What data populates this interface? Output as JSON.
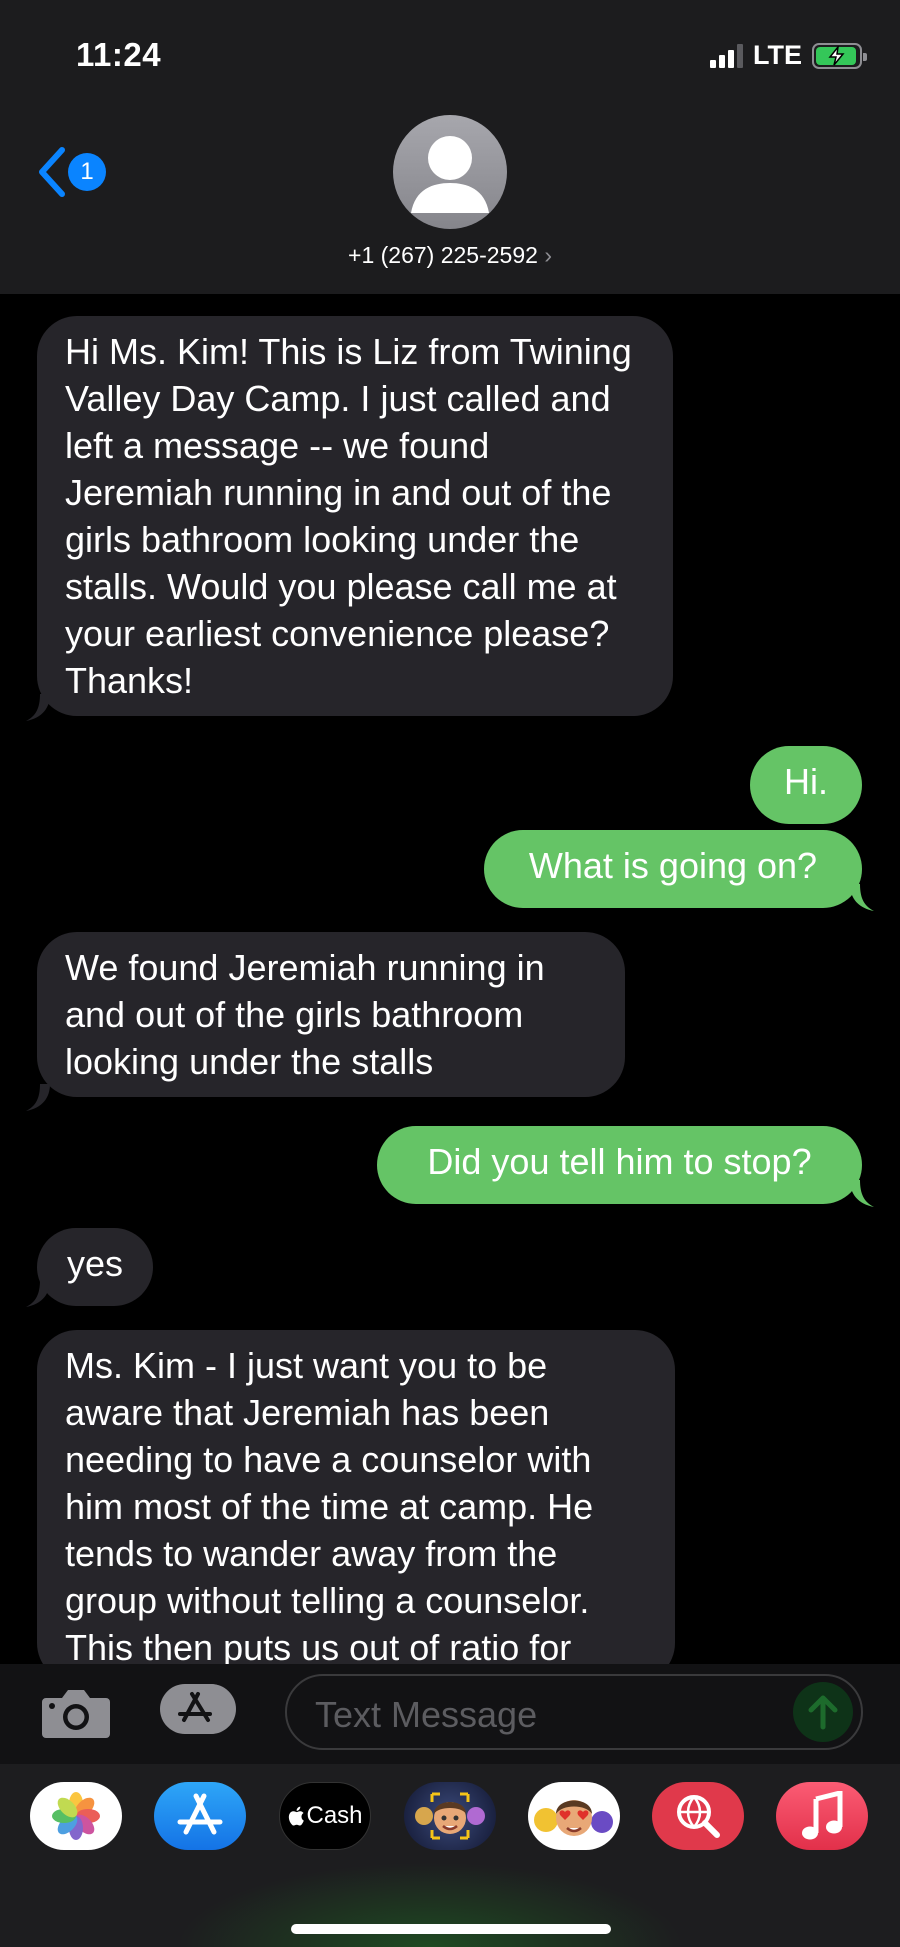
{
  "status_bar": {
    "time": "11:24",
    "network": "LTE"
  },
  "header": {
    "back_badge": "1",
    "contact_name": "+1 (267) 225-2592",
    "chevron": "›"
  },
  "messages": [
    {
      "dir": "in",
      "text": "Hi Ms. Kim! This is Liz from Twining Valley Day Camp. I just called and left a message -- we found Jeremiah running in and out of the girls bathroom looking under the stalls. Would you please call me at your earliest convenience please? Thanks!"
    },
    {
      "dir": "out",
      "text": "Hi."
    },
    {
      "dir": "out",
      "text": "What is going on?"
    },
    {
      "dir": "in",
      "text": "We found Jeremiah running in and out of the girls bathroom looking under the stalls"
    },
    {
      "dir": "out",
      "text": "Did you tell him to stop?"
    },
    {
      "dir": "in",
      "text": "yes"
    },
    {
      "dir": "in",
      "text": "Ms. Kim - I just want you to be aware that Jeremiah has been needing to have a counselor with him most of the time at camp. He tends to wander away from the group without telling a counselor. This then puts us out of ratio for"
    }
  ],
  "composer": {
    "placeholder": "Text Message"
  },
  "app_drawer": {
    "apps": [
      {
        "name": "Photos",
        "icon": "photos-icon"
      },
      {
        "name": "App Store",
        "icon": "app-store-icon"
      },
      {
        "name": "Cash",
        "label": "Cash",
        "icon": "apple-cash-icon"
      },
      {
        "name": "Memoji",
        "icon": "memoji-icon"
      },
      {
        "name": "Memoji Stickers",
        "icon": "memoji-stickers-icon"
      },
      {
        "name": "Web Images",
        "icon": "web-search-icon"
      },
      {
        "name": "Music",
        "icon": "music-icon"
      }
    ]
  },
  "colors": {
    "incoming": "#26252a",
    "outgoing": "#65c466",
    "accent": "#0a84ff"
  }
}
